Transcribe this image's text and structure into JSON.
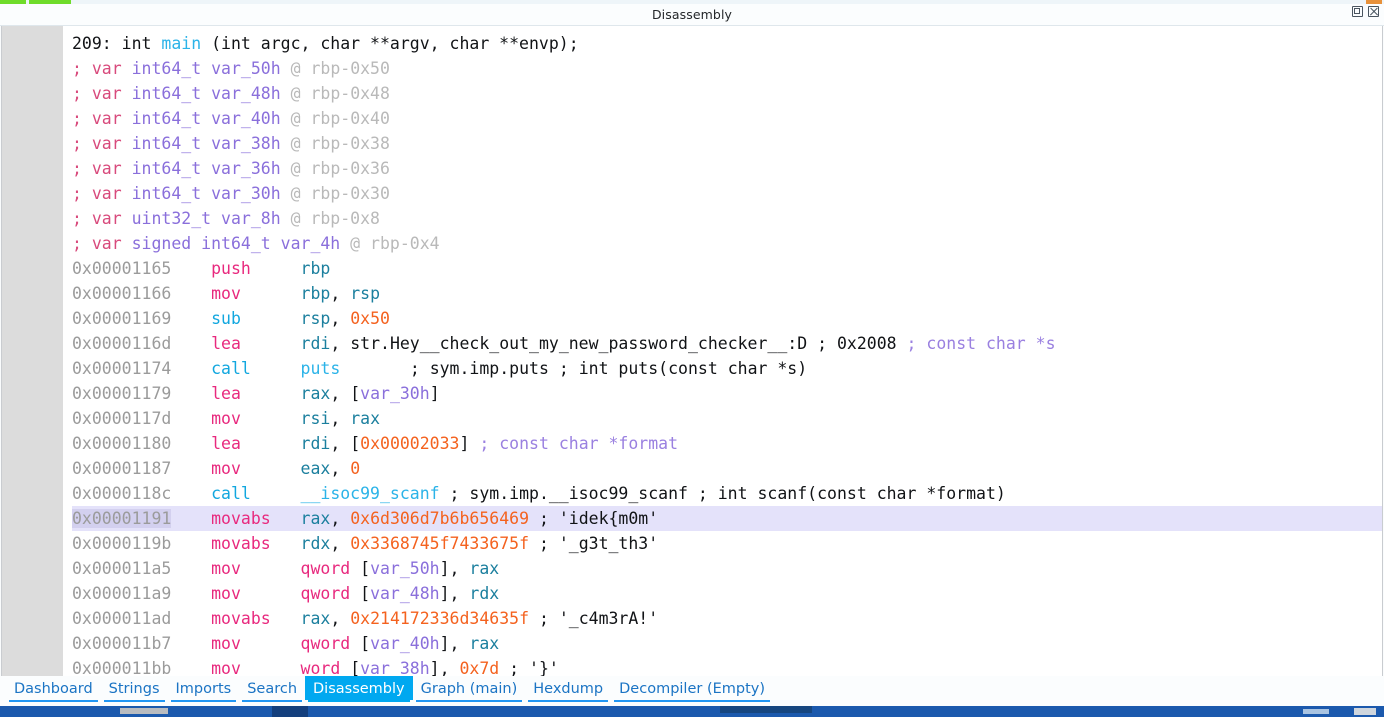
{
  "window": {
    "title": "Disassembly",
    "controls": [
      {
        "name": "restore-button",
        "label": "restore-icon"
      },
      {
        "name": "close-button",
        "label": "close-icon"
      }
    ]
  },
  "code": {
    "header": {
      "num": "209:",
      "ret": " int ",
      "fn": "main",
      "sig": " (int argc, char **argv, char **envp);"
    },
    "vars": [
      {
        "semi": "; ",
        "kw": "var ",
        "type": "int64_t ",
        "name": "var_50h",
        "at": " @ rbp-0x50"
      },
      {
        "semi": "; ",
        "kw": "var ",
        "type": "int64_t ",
        "name": "var_48h",
        "at": " @ rbp-0x48"
      },
      {
        "semi": "; ",
        "kw": "var ",
        "type": "int64_t ",
        "name": "var_40h",
        "at": " @ rbp-0x40"
      },
      {
        "semi": "; ",
        "kw": "var ",
        "type": "int64_t ",
        "name": "var_38h",
        "at": " @ rbp-0x38"
      },
      {
        "semi": "; ",
        "kw": "var ",
        "type": "int64_t ",
        "name": "var_36h",
        "at": " @ rbp-0x36"
      },
      {
        "semi": "; ",
        "kw": "var ",
        "type": "int64_t ",
        "name": "var_30h",
        "at": " @ rbp-0x30"
      },
      {
        "semi": "; ",
        "kw": "var ",
        "type": "uint32_t ",
        "name": "var_8h",
        "at": " @ rbp-0x8"
      },
      {
        "semi": "; ",
        "kw": "var ",
        "type": "signed int64_t ",
        "name": "var_4h",
        "at": " @ rbp-0x4"
      }
    ],
    "instructions": [
      {
        "addr": "0x00001165",
        "mnemonic": "push",
        "mnemonic_color": "pink",
        "operands": [
          {
            "t": "reg",
            "v": "rbp"
          }
        ],
        "highlight": false
      },
      {
        "addr": "0x00001166",
        "mnemonic": "mov",
        "mnemonic_color": "pink",
        "operands": [
          {
            "t": "reg",
            "v": "rbp"
          },
          {
            "t": "sym",
            "v": ", "
          },
          {
            "t": "reg",
            "v": "rsp"
          }
        ],
        "highlight": false
      },
      {
        "addr": "0x00001169",
        "mnemonic": "sub",
        "mnemonic_color": "cyan",
        "operands": [
          {
            "t": "reg",
            "v": "rsp"
          },
          {
            "t": "sym",
            "v": ", "
          },
          {
            "t": "num",
            "v": "0x50"
          }
        ],
        "highlight": false
      },
      {
        "addr": "0x0000116d",
        "mnemonic": "lea",
        "mnemonic_color": "pink",
        "operands": [
          {
            "t": "reg",
            "v": "rdi"
          },
          {
            "t": "sym",
            "v": ", "
          },
          {
            "t": "plain",
            "v": "str.Hey__check_out_my_new_password_checker__:D"
          },
          {
            "t": "semi",
            "v": " ; "
          },
          {
            "t": "plain",
            "v": "0x2008"
          },
          {
            "t": "annot",
            "v": " ; const char *s"
          }
        ],
        "highlight": false
      },
      {
        "addr": "0x00001174",
        "mnemonic": "call",
        "mnemonic_color": "cyan",
        "operands": [
          {
            "t": "fn",
            "v": "puts"
          },
          {
            "t": "plain",
            "v": "       "
          },
          {
            "t": "semi",
            "v": "; "
          },
          {
            "t": "plain",
            "v": "sym.imp.puts ; int puts(const char *s)"
          }
        ],
        "highlight": false
      },
      {
        "addr": "0x00001179",
        "mnemonic": "lea",
        "mnemonic_color": "pink",
        "operands": [
          {
            "t": "reg",
            "v": "rax"
          },
          {
            "t": "sym",
            "v": ", ["
          },
          {
            "t": "var",
            "v": "var_30h"
          },
          {
            "t": "sym",
            "v": "]"
          }
        ],
        "highlight": false
      },
      {
        "addr": "0x0000117d",
        "mnemonic": "mov",
        "mnemonic_color": "pink",
        "operands": [
          {
            "t": "reg",
            "v": "rsi"
          },
          {
            "t": "sym",
            "v": ", "
          },
          {
            "t": "reg",
            "v": "rax"
          }
        ],
        "highlight": false
      },
      {
        "addr": "0x00001180",
        "mnemonic": "lea",
        "mnemonic_color": "pink",
        "operands": [
          {
            "t": "reg",
            "v": "rdi"
          },
          {
            "t": "sym",
            "v": ", ["
          },
          {
            "t": "num",
            "v": "0x00002033"
          },
          {
            "t": "sym",
            "v": "]"
          },
          {
            "t": "annot",
            "v": " ; const char *format"
          }
        ],
        "highlight": false
      },
      {
        "addr": "0x00001187",
        "mnemonic": "mov",
        "mnemonic_color": "pink",
        "operands": [
          {
            "t": "reg",
            "v": "eax"
          },
          {
            "t": "sym",
            "v": ", "
          },
          {
            "t": "num",
            "v": "0"
          }
        ],
        "highlight": false
      },
      {
        "addr": "0x0000118c",
        "mnemonic": "call",
        "mnemonic_color": "cyan",
        "operands": [
          {
            "t": "fn",
            "v": "__isoc99_scanf"
          },
          {
            "t": "semi",
            "v": " ; "
          },
          {
            "t": "plain",
            "v": "sym.imp.__isoc99_scanf ; int scanf(const char *format)"
          }
        ],
        "highlight": false
      },
      {
        "addr": "0x00001191",
        "mnemonic": "movabs",
        "mnemonic_color": "pink",
        "operands": [
          {
            "t": "reg",
            "v": "rax"
          },
          {
            "t": "sym",
            "v": ", "
          },
          {
            "t": "num",
            "v": "0x6d306d7b6b656469"
          },
          {
            "t": "semi",
            "v": " ; "
          },
          {
            "t": "str",
            "v": "'idek{m0m'"
          }
        ],
        "highlight": true
      },
      {
        "addr": "0x0000119b",
        "mnemonic": "movabs",
        "mnemonic_color": "pink",
        "operands": [
          {
            "t": "reg",
            "v": "rdx"
          },
          {
            "t": "sym",
            "v": ", "
          },
          {
            "t": "num",
            "v": "0x3368745f7433675f"
          },
          {
            "t": "semi",
            "v": " ; "
          },
          {
            "t": "str",
            "v": "'_g3t_th3'"
          }
        ],
        "highlight": false
      },
      {
        "addr": "0x000011a5",
        "mnemonic": "mov",
        "mnemonic_color": "pink",
        "operands": [
          {
            "t": "kw",
            "v": "qword "
          },
          {
            "t": "sym",
            "v": "["
          },
          {
            "t": "var",
            "v": "var_50h"
          },
          {
            "t": "sym",
            "v": "], "
          },
          {
            "t": "reg",
            "v": "rax"
          }
        ],
        "highlight": false
      },
      {
        "addr": "0x000011a9",
        "mnemonic": "mov",
        "mnemonic_color": "pink",
        "operands": [
          {
            "t": "kw",
            "v": "qword "
          },
          {
            "t": "sym",
            "v": "["
          },
          {
            "t": "var",
            "v": "var_48h"
          },
          {
            "t": "sym",
            "v": "], "
          },
          {
            "t": "reg",
            "v": "rdx"
          }
        ],
        "highlight": false
      },
      {
        "addr": "0x000011ad",
        "mnemonic": "movabs",
        "mnemonic_color": "pink",
        "operands": [
          {
            "t": "reg",
            "v": "rax"
          },
          {
            "t": "sym",
            "v": ", "
          },
          {
            "t": "num",
            "v": "0x214172336d34635f"
          },
          {
            "t": "semi",
            "v": " ; "
          },
          {
            "t": "str",
            "v": "'_c4m3rA!'"
          }
        ],
        "highlight": false
      },
      {
        "addr": "0x000011b7",
        "mnemonic": "mov",
        "mnemonic_color": "pink",
        "operands": [
          {
            "t": "kw",
            "v": "qword "
          },
          {
            "t": "sym",
            "v": "["
          },
          {
            "t": "var",
            "v": "var_40h"
          },
          {
            "t": "sym",
            "v": "], "
          },
          {
            "t": "reg",
            "v": "rax"
          }
        ],
        "highlight": false
      },
      {
        "addr": "0x000011bb",
        "mnemonic": "mov",
        "mnemonic_color": "pink",
        "operands": [
          {
            "t": "kw",
            "v": "word "
          },
          {
            "t": "sym",
            "v": "["
          },
          {
            "t": "var",
            "v": "var_38h"
          },
          {
            "t": "sym",
            "v": "], "
          },
          {
            "t": "num",
            "v": "0x7d"
          },
          {
            "t": "semi",
            "v": " ; "
          },
          {
            "t": "str",
            "v": "'}'"
          }
        ],
        "highlight": false
      }
    ]
  },
  "tabs": [
    {
      "label": "Dashboard",
      "name": "tab-dashboard",
      "active": false
    },
    {
      "label": "Strings",
      "name": "tab-strings",
      "active": false
    },
    {
      "label": "Imports",
      "name": "tab-imports",
      "active": false
    },
    {
      "label": "Search",
      "name": "tab-search",
      "active": false
    },
    {
      "label": "Disassembly",
      "name": "tab-disassembly",
      "active": true
    },
    {
      "label": "Graph (main)",
      "name": "tab-graph",
      "active": false
    },
    {
      "label": "Hexdump",
      "name": "tab-hexdump",
      "active": false
    },
    {
      "label": "Decompiler (Empty)",
      "name": "tab-decompiler",
      "active": false
    }
  ],
  "colors": {
    "accent": "#00a8f0",
    "tab_text": "#1b74c4",
    "highlight_row": "#e4e2fa",
    "gutter": "#dcdcdc",
    "taskbar": "#1b59ad"
  }
}
